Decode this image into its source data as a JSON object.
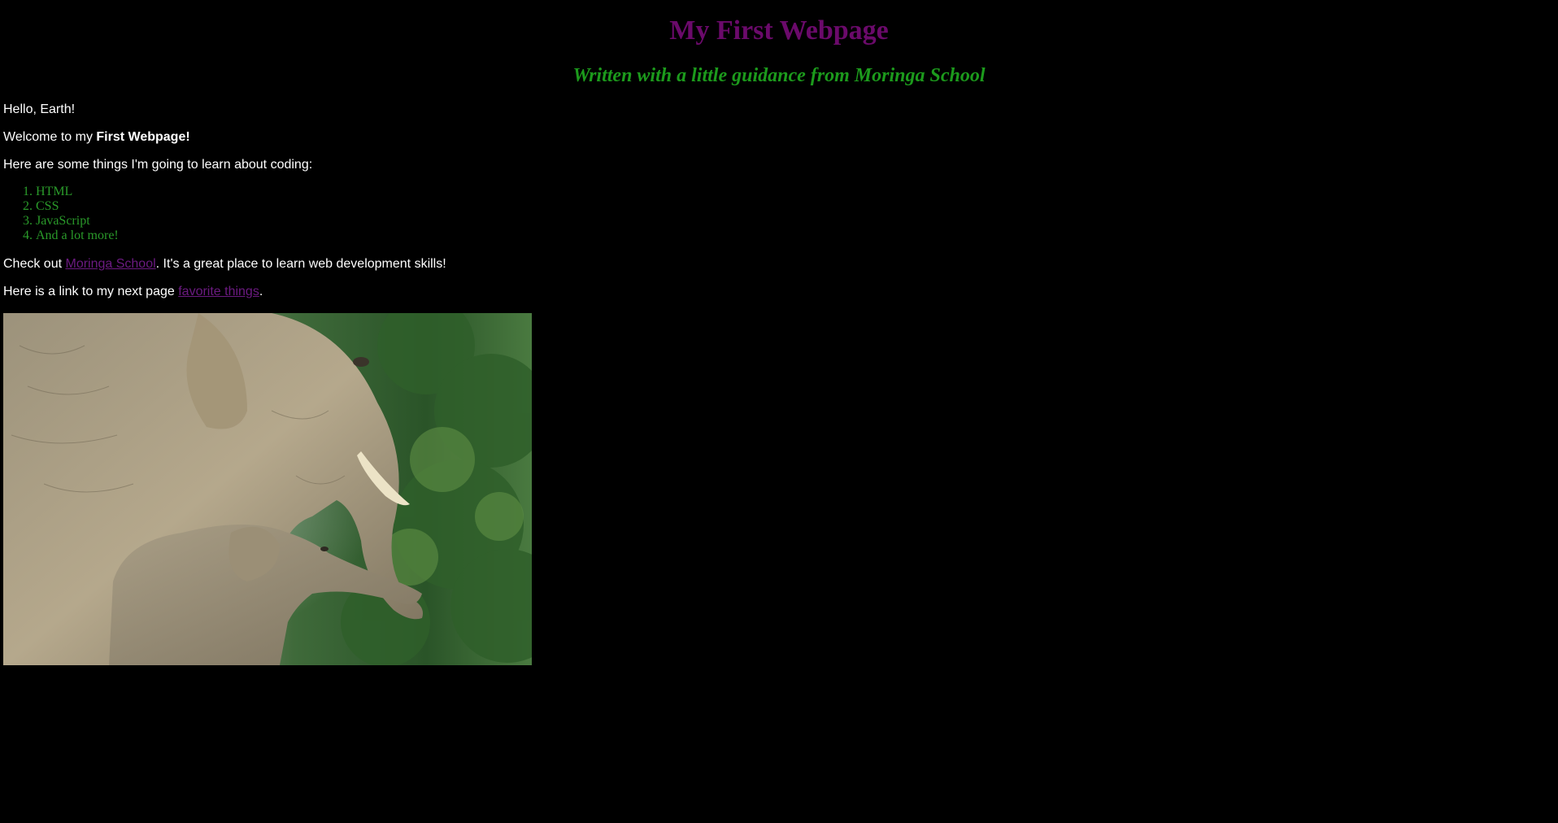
{
  "page": {
    "title": "My First Webpage",
    "subtitle": "Written with a little guidance from Moringa School"
  },
  "content": {
    "hello": "Hello, Earth!",
    "welcome_prefix": "Welcome to my ",
    "welcome_bold": "First Webpage!",
    "things_intro": "Here are some things I'm going to learn about coding:",
    "learn_list": [
      "HTML",
      "CSS",
      "JavaScript",
      "And a lot more!"
    ],
    "check_prefix": "Check out ",
    "check_link": "Moringa School",
    "check_suffix": ". It's a great place to learn web development skills!",
    "next_prefix": "Here is a link to my next page ",
    "next_link": "favorite things",
    "next_suffix": "."
  },
  "image": {
    "subject": "elephant-mother-and-calf"
  },
  "colors": {
    "background": "#000000",
    "title": "#6b0a6b",
    "subtitle": "#1c9a1c",
    "list": "#2a9a2a",
    "link": "#6b1a80",
    "text": "#ffffff"
  }
}
